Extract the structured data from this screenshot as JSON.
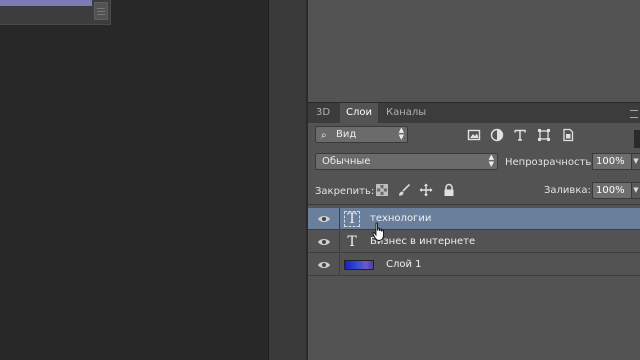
{
  "tabs": [
    {
      "label": "3D",
      "active": false
    },
    {
      "label": "Слои",
      "active": true
    },
    {
      "label": "Каналы",
      "active": false
    }
  ],
  "filter": {
    "label": "Вид",
    "icons": [
      "image-filter-icon",
      "adjustment-filter-icon",
      "type-filter-icon",
      "shape-filter-icon",
      "smart-object-filter-icon"
    ]
  },
  "blend_mode": {
    "value": "Обычные"
  },
  "opacity": {
    "label": "Непрозрачность:",
    "value": "100%"
  },
  "lock": {
    "label": "Закрепить:",
    "icons": [
      "lock-transparent-icon",
      "lock-paint-icon",
      "lock-move-icon",
      "lock-all-icon"
    ]
  },
  "fill": {
    "label": "Заливка:",
    "value": "100%"
  },
  "layers": [
    {
      "name": "технологии",
      "type": "text",
      "selected": true,
      "visible": true
    },
    {
      "name": "Бизнес в интернете",
      "type": "text",
      "selected": false,
      "visible": true
    },
    {
      "name": "Слой 1",
      "type": "image",
      "selected": false,
      "visible": true
    }
  ],
  "colors": {
    "panel": "#535353",
    "selected_layer": "#6a7f9c",
    "tab_bar": "#3c3c3c",
    "canvas": "#282828"
  }
}
